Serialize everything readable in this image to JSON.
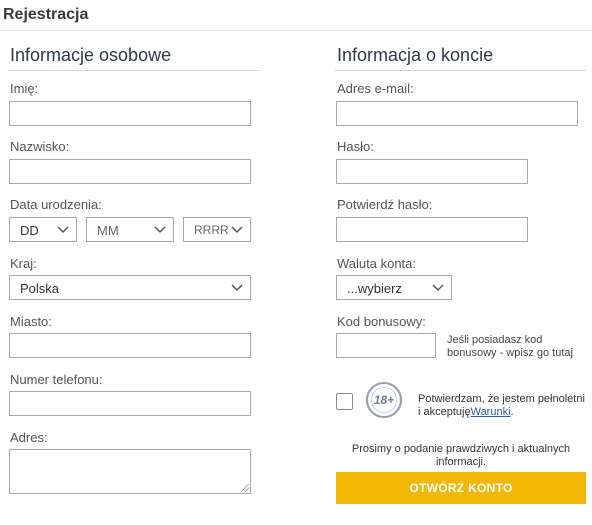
{
  "header": {
    "title": "Rejestracja"
  },
  "personal": {
    "heading": "Informacje osobowe",
    "first_name_label": "Imię:",
    "last_name_label": "Nazwisko:",
    "birthdate_label": "Data urodzenia:",
    "day_value": "DD",
    "month_value": "MM",
    "year_value": "RRRR",
    "country_label": "Kraj:",
    "country_value": "Polska",
    "city_label": "Miasto:",
    "phone_label": "Numer telefonu:",
    "address_label": "Adres:"
  },
  "account": {
    "heading": "Informacja o koncie",
    "email_label": "Adres e-mail:",
    "password_label": "Hasło:",
    "confirm_password_label": "Potwierdź hasło:",
    "currency_label": "Waluta konta:",
    "currency_value": "...wybierz",
    "bonus_label": "Kod bonusowy:",
    "bonus_hint": "Jeśli posiadasz kod bonusowy - wpisz go tutaj",
    "age_badge": "18+",
    "terms_text": "Potwierdzam, że jestem pełnoletni i akceptuję",
    "terms_link": "Warunki",
    "terms_end": ".",
    "note": "Prosimy o podanie prawdziwych i aktualnych informacji.",
    "submit_label": "OTWÓRZ KONTO"
  },
  "colors": {
    "button": "#f2b705",
    "link": "#2a5ea8",
    "heading": "#2b3a4f"
  }
}
